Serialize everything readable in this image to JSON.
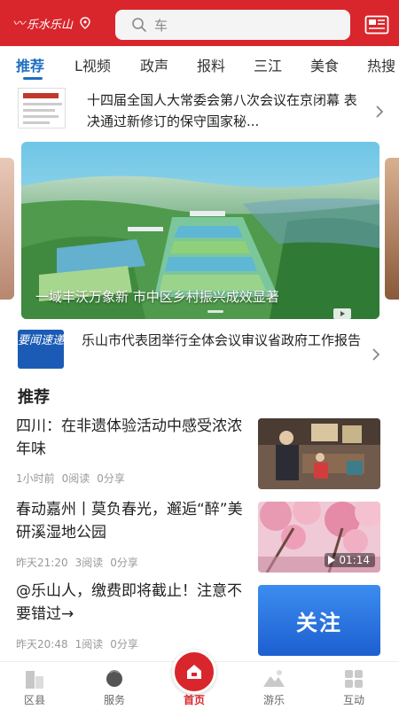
{
  "header": {
    "logo_text": "乐水乐山",
    "search_placeholder": "车",
    "brand_color": "#d9262c"
  },
  "tabs": [
    {
      "label": "推荐",
      "active": true
    },
    {
      "label": "L视频",
      "active": false
    },
    {
      "label": "政声",
      "active": false
    },
    {
      "label": "报料",
      "active": false
    },
    {
      "label": "三江",
      "active": false
    },
    {
      "label": "美食",
      "active": false
    },
    {
      "label": "热搜",
      "active": false
    }
  ],
  "headline": {
    "text": "十四届全国人大常委会第八次会议在京闭幕 表决通过新修订的保守国家秘..."
  },
  "carousel": {
    "caption": "一域丰沃万象新 市中区乡村振兴成效显著"
  },
  "key_news": {
    "icon_label": "要闻速递",
    "text": "乐山市代表团举行全体会议审议省政府工作报告"
  },
  "section_title": "推荐",
  "articles": [
    {
      "title": "四川：在非遗体验活动中感受浓浓年味",
      "time": "1小时前",
      "reads": "0阅读",
      "shares": "0分享"
    },
    {
      "title": "春动嘉州丨莫负春光，邂逅“醉”美研溪湿地公园",
      "time": "昨天21:20",
      "reads": "3阅读",
      "shares": "0分享",
      "duration": "01:14"
    },
    {
      "title": "@乐山人，缴费即将截止！注意不要错过→",
      "time": "昨天20:48",
      "reads": "1阅读",
      "shares": "0分享",
      "thumb_text": "关注"
    }
  ],
  "bottom_nav": [
    {
      "label": "区县",
      "icon": "county-icon"
    },
    {
      "label": "服务",
      "icon": "service-icon"
    },
    {
      "label": "首页",
      "icon": "home-icon",
      "active": true
    },
    {
      "label": "游乐",
      "icon": "travel-icon"
    },
    {
      "label": "互动",
      "icon": "interact-icon"
    }
  ]
}
